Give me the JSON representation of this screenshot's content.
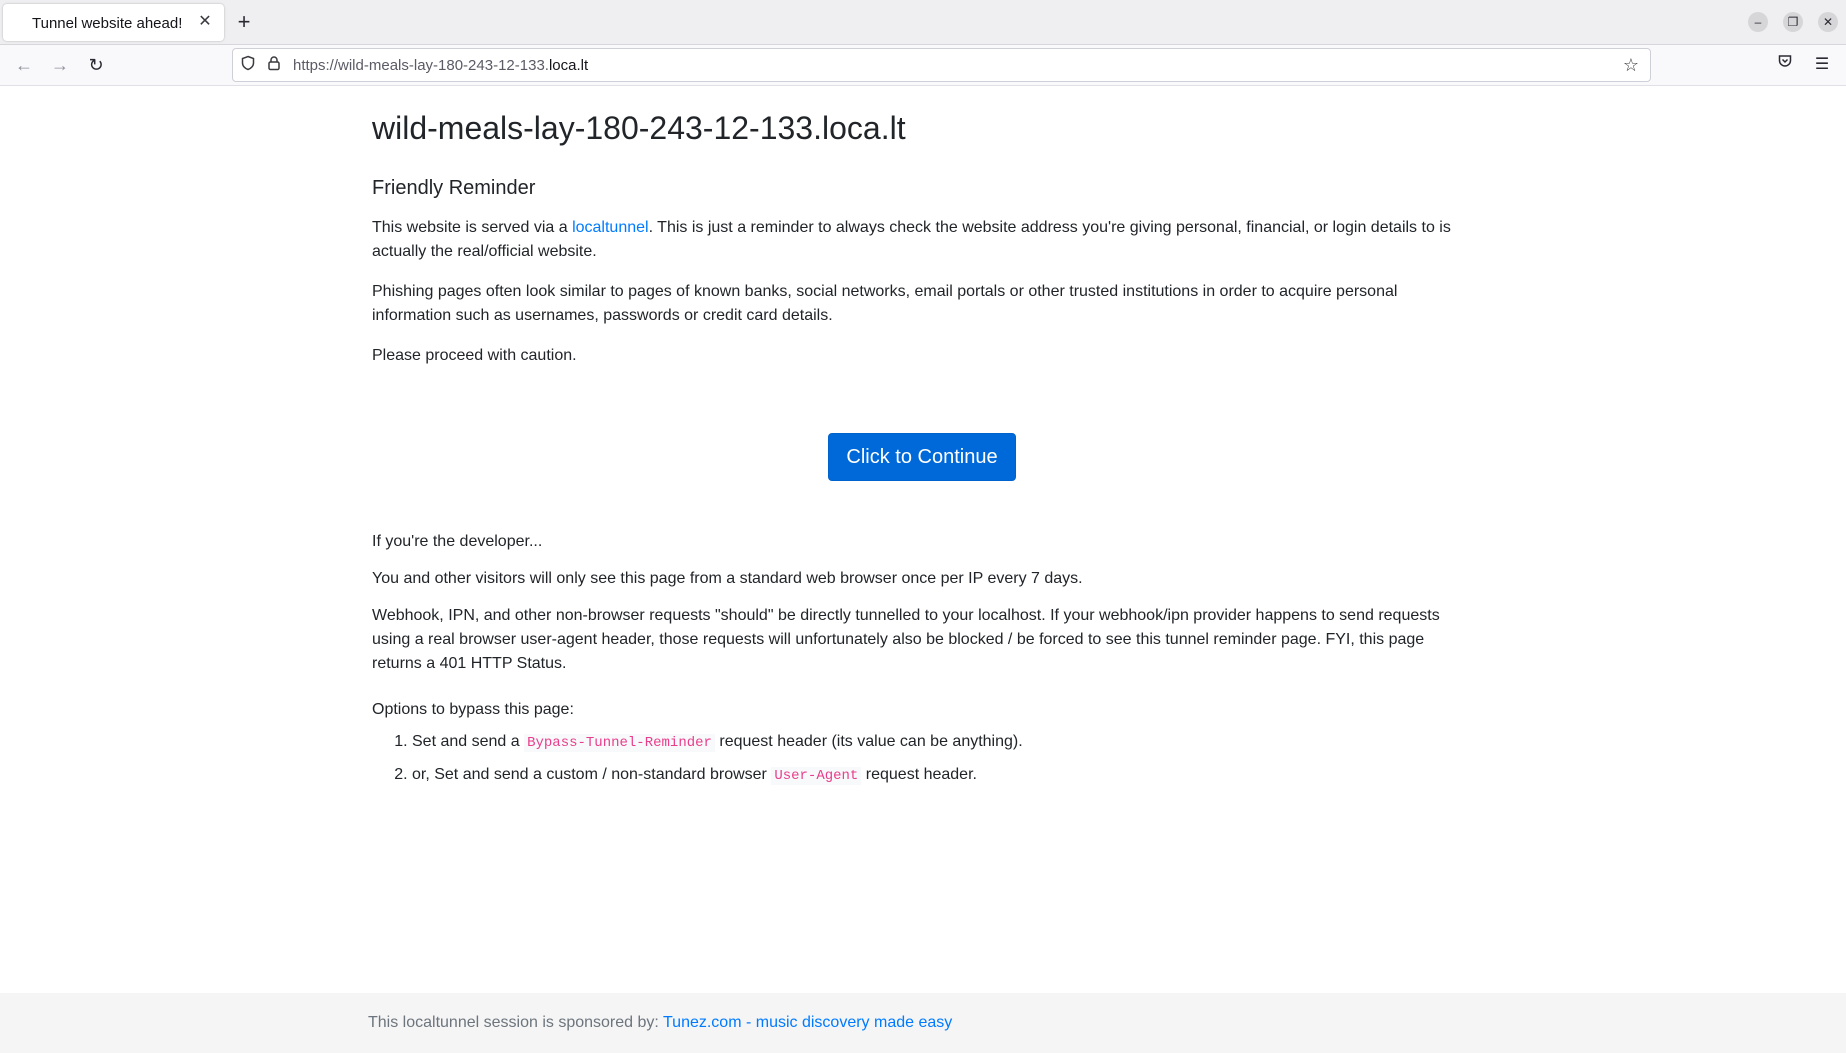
{
  "browser": {
    "tab_title": "Tunnel website ahead!",
    "url_prefix": "https://wild-meals-lay-180-243-12-133.",
    "url_host": "loca.lt"
  },
  "page": {
    "site_heading": "wild-meals-lay-180-243-12-133.loca.lt",
    "reminder_heading": "Friendly Reminder",
    "p1_before": "This website is served via a ",
    "p1_link": "localtunnel",
    "p1_after": ". This is just a reminder to always check the website address you're giving personal, financial, or login details to is actually the real/official website.",
    "p2": "Phishing pages often look similar to pages of known banks, social networks, email portals or other trusted institutions in order to acquire personal information such as usernames, passwords or credit card details.",
    "p3": "Please proceed with caution.",
    "continue_button": "Click to Continue",
    "dev_heading": "If you're the developer...",
    "dev_p1": "You and other visitors will only see this page from a standard web browser once per IP every 7 days.",
    "dev_p2": "Webhook, IPN, and other non-browser requests \"should\" be directly tunnelled to your localhost. If your webhook/ipn provider happens to send requests using a real browser user-agent header, those requests will unfortunately also be blocked / be forced to see this tunnel reminder page. FYI, this page returns a 401 HTTP Status.",
    "options_heading": "Options to bypass this page:",
    "opt1_before": "Set and send a ",
    "opt1_code": "Bypass-Tunnel-Reminder",
    "opt1_after": " request header (its value can be anything).",
    "opt2_before": "or, Set and send a custom / non-standard browser ",
    "opt2_code": "User-Agent",
    "opt2_after": " request header."
  },
  "footer": {
    "text": "This localtunnel session is sponsored by: ",
    "link": "Tunez.com - music discovery made easy"
  },
  "colors": {
    "link": "#007bff",
    "button": "#0069d9",
    "code": "#e83e8c"
  }
}
